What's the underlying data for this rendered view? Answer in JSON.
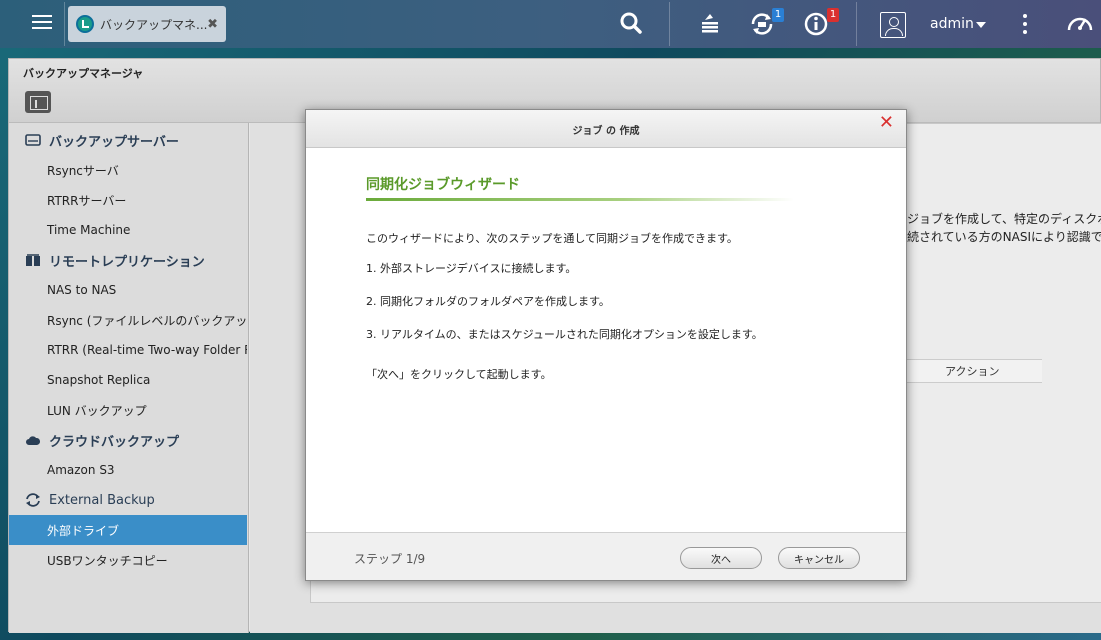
{
  "topbar": {
    "app_tab_title": "バックアップマネ...",
    "close_glyph": "✖",
    "user_name": "admin",
    "notifications": [
      {
        "icon": "task-stack-icon",
        "badge": ""
      },
      {
        "icon": "backup-sync-icon",
        "badge": "1",
        "badge_color": "#2a7fd4"
      },
      {
        "icon": "info-icon",
        "badge": "1",
        "badge_color": "#d9302f"
      }
    ]
  },
  "window": {
    "title": "バックアップマネージャ"
  },
  "sidebar": {
    "groups": [
      {
        "label": "バックアップサーバー",
        "icon": "server-icon",
        "items": [
          "Rsyncサーバ",
          "RTRRサーバー",
          "Time Machine"
        ]
      },
      {
        "label": "リモートレプリケーション",
        "icon": "replication-icon",
        "items": [
          "NAS to NAS",
          "Rsync (ファイルレベルのバックアップ)",
          "RTRR (Real-time Two-way Folder Replication)",
          "Snapshot Replica",
          "LUN バックアップ"
        ]
      },
      {
        "label": "クラウドバックアップ",
        "icon": "cloud-icon",
        "items": [
          "Amazon S3"
        ]
      },
      {
        "label": "External Backup",
        "icon": "sync-arrows-icon",
        "items": [
          "外部ドライブ",
          "USBワンタッチコピー"
        ]
      }
    ],
    "active_item": "外部ドライブ"
  },
  "background": {
    "line1": "ジョブを作成して、特定のディスクボリュー",
    "line2": "続されている方のNASIにより認識できま",
    "action_column": "アクション"
  },
  "modal": {
    "title": "ジョブ の 作成",
    "close_glyph": "✕",
    "heading": "同期化ジョブウィザード",
    "intro": "このウィザードにより、次のステップを通して同期ジョブを作成できます。",
    "steps": [
      "1. 外部ストレージデバイスに接続します。",
      "2. 同期化フォルダのフォルダペアを作成します。",
      "3. リアルタイムの、またはスケジュールされた同期化オプションを設定します。"
    ],
    "start_hint": "「次へ」をクリックして起動します。",
    "step_indicator": "ステップ 1/9",
    "next_button": "次へ",
    "cancel_button": "キャンセル"
  }
}
